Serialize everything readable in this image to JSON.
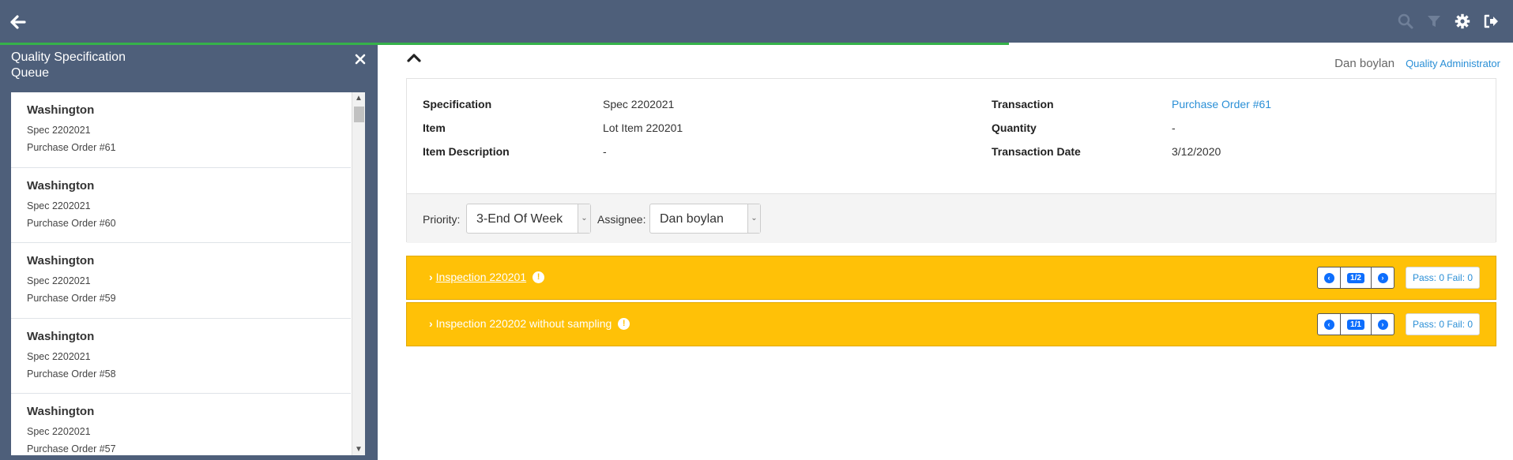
{
  "header": {
    "back_icon": "arrow-left-icon",
    "tools": [
      "search-icon",
      "filter-icon",
      "gear-icon",
      "logout-icon"
    ],
    "progress_fraction": 0.667
  },
  "sidebar": {
    "title_line1": "Quality Specification",
    "title_line2": "Queue",
    "items": [
      {
        "name": "Washington",
        "spec": "Spec 2202021",
        "order": "Purchase Order #61"
      },
      {
        "name": "Washington",
        "spec": "Spec 2202021",
        "order": "Purchase Order #60"
      },
      {
        "name": "Washington",
        "spec": "Spec 2202021",
        "order": "Purchase Order #59"
      },
      {
        "name": "Washington",
        "spec": "Spec 2202021",
        "order": "Purchase Order #58"
      },
      {
        "name": "Washington",
        "spec": "Spec 2202021",
        "order": "Purchase Order #57"
      }
    ]
  },
  "user": {
    "name": "Dan boylan",
    "role": "Quality Administrator"
  },
  "details": {
    "specification_label": "Specification",
    "specification_value": "Spec 2202021",
    "item_label": "Item",
    "item_value": "Lot Item 220201",
    "item_description_label": "Item Description",
    "item_description_value": "-",
    "transaction_label": "Transaction",
    "transaction_value": "Purchase Order #61",
    "quantity_label": "Quantity",
    "quantity_value": "-",
    "transaction_date_label": "Transaction Date",
    "transaction_date_value": "3/12/2020",
    "priority_label": "Priority:",
    "priority_value": "3-End Of Week",
    "assignee_label": "Assignee:",
    "assignee_value": "Dan boylan"
  },
  "inspections": [
    {
      "label": "Inspection 220201",
      "pager": "1/2",
      "passfail": "Pass: 0 Fail: 0",
      "underline": true
    },
    {
      "label": "Inspection 220202 without sampling",
      "pager": "1/1",
      "passfail": "Pass: 0 Fail: 0",
      "underline": false
    }
  ],
  "colors": {
    "header_bg": "#4e5f7a",
    "progress": "#36b24a",
    "inspection_bg": "#ffc107",
    "link": "#2a8fd6"
  }
}
